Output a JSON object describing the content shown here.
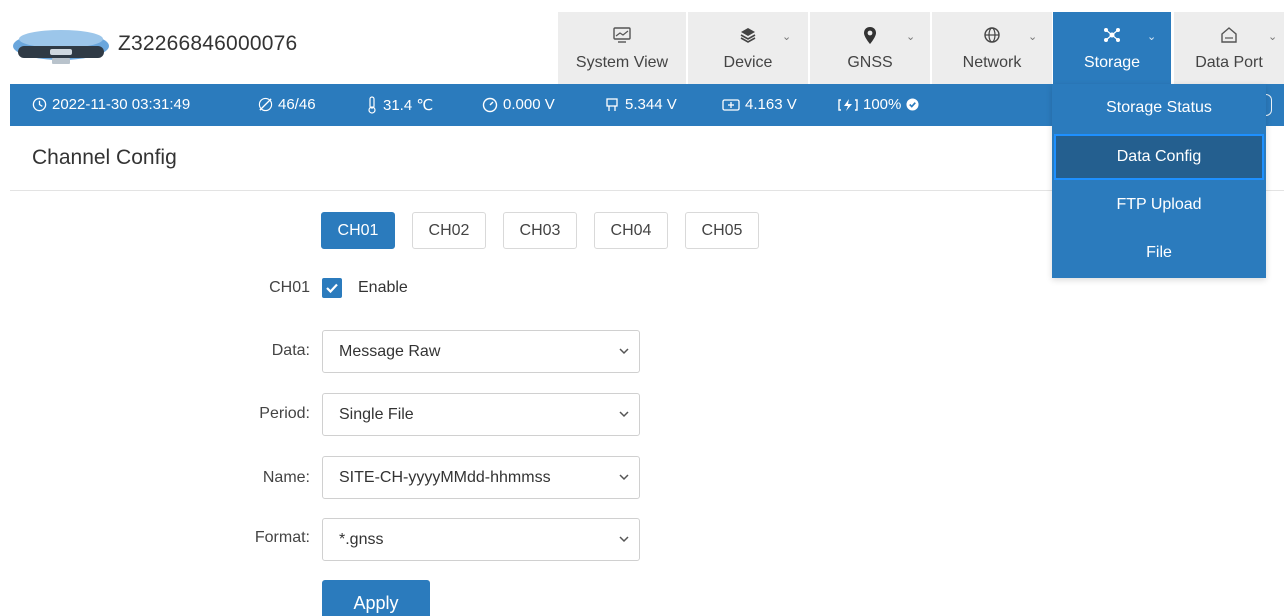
{
  "header": {
    "serial": "Z32266846000076",
    "tabs": [
      {
        "label": "System View",
        "icon": "monitor-icon",
        "has_dropdown": false,
        "active": false
      },
      {
        "label": "Device",
        "icon": "layers-icon",
        "has_dropdown": true,
        "active": false
      },
      {
        "label": "GNSS",
        "icon": "location-pin-icon",
        "has_dropdown": true,
        "active": false
      },
      {
        "label": "Network",
        "icon": "globe-icon",
        "has_dropdown": true,
        "active": false
      },
      {
        "label": "Storage",
        "icon": "storage-icon",
        "has_dropdown": true,
        "active": true
      },
      {
        "label": "Data Port",
        "icon": "home-icon",
        "has_dropdown": true,
        "active": false
      }
    ]
  },
  "status": {
    "datetime": "2022-11-30 03:31:49",
    "satellites": "46/46",
    "temperature": "31.4 ℃",
    "voltage1": "0.000 V",
    "voltage2": "5.344 V",
    "voltage3": "4.163 V",
    "battery": "100%"
  },
  "storage_menu": {
    "items": [
      "Storage Status",
      "Data Config",
      "FTP Upload",
      "File"
    ],
    "active": "Data Config"
  },
  "page": {
    "title": "Channel Config",
    "channels": [
      "CH01",
      "CH02",
      "CH03",
      "CH04",
      "CH05"
    ],
    "active_channel": "CH01"
  },
  "form": {
    "channel_label": "CH01",
    "enable_label": "Enable",
    "enable_checked": true,
    "data_label": "Data:",
    "data_value": "Message Raw",
    "period_label": "Period:",
    "period_value": "Single File",
    "name_label": "Name:",
    "name_value": "SITE-CH-yyyyMMdd-hhmmss",
    "format_label": "Format:",
    "format_value": "*.gnss",
    "apply_label": "Apply"
  },
  "colors": {
    "accent": "#2b7bbd",
    "tab_bg": "#ededed",
    "menu_active_bg": "#245f8f",
    "menu_active_border": "#1e90ff"
  }
}
